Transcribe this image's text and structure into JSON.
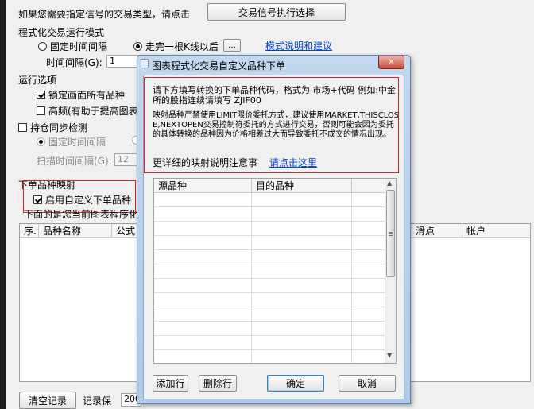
{
  "main": {
    "signal_prompt": "如果您需要指定信号的交易类型，请点击",
    "signal_button": "交易信号执行选择",
    "mode_group": "程式化交易运行模式",
    "radio_fixed": "固定时间间隔",
    "radio_kline": "走完一根K线以后",
    "kline_more_button": "...",
    "mode_help_link": "模式说明和建议",
    "interval_label": "时间间隔(G):",
    "interval_value": "1",
    "options_group": "运行选项",
    "lock_screen": "锁定画面所有品种",
    "high_freq": "高频(有助于提高图表",
    "position_sync": "持仓同步检测",
    "sync_fixed": "固定时间间隔",
    "scan_label": "扫描时间间隔(G):",
    "scan_value": "12",
    "mapping_group": "下单品种映射",
    "enable_custom": "启用自定义下单品种",
    "table_note": "下面的是您当前图表程序化",
    "table_headers": [
      "序.",
      "品种名称",
      "公式",
      "滑点",
      "帐户"
    ],
    "clear_button": "清空记录",
    "record_label": "记录保",
    "record_value": "200"
  },
  "dialog": {
    "title": "图表程式化交易自定义品种下单",
    "close_label": "✕",
    "instruction": "请下方填写转换的下单品种代码，格式为 市场+代码 例如:中金所的股指连续请填写 ZJIF00",
    "warning": "映射品种严禁使用LIMIT限价委托方式，建议使用MARKET,THISCLOSE,NEXTOPEN交易控制符委托的方式进行交易，否则可能会因为委托的具体转换的品种因为价格相差过大而导致委托不成交的情况出现。",
    "more_info": "更详细的映射说明注意事",
    "more_link": "请点击这里",
    "columns": [
      "源品种",
      "目的品种"
    ],
    "add_row": "添加行",
    "delete_row": "删除行",
    "ok": "确定",
    "cancel": "取消"
  }
}
